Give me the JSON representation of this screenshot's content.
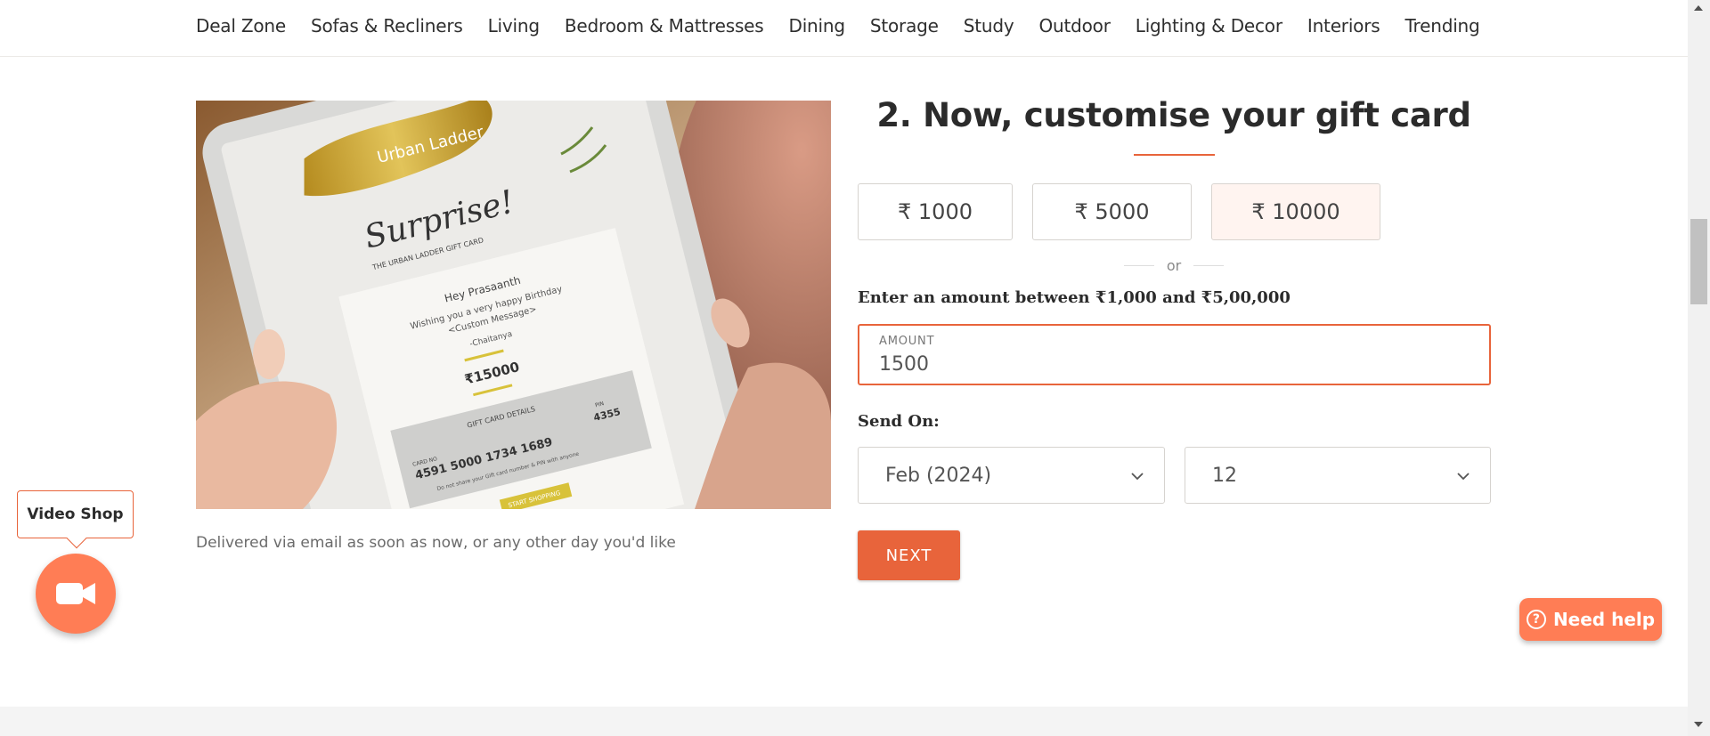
{
  "nav": {
    "items": [
      "Deal Zone",
      "Sofas & Recliners",
      "Living",
      "Bedroom & Mattresses",
      "Dining",
      "Storage",
      "Study",
      "Outdoor",
      "Lighting & Decor",
      "Interiors",
      "Trending"
    ]
  },
  "hero": {
    "card_brand": "Urban Ladder",
    "card_headline": "Surprise!",
    "card_subtitle": "THE URBAN LADDER GIFT CARD",
    "card_greeting": "Hey Prasaanth",
    "card_message_1": "Wishing you a very happy Birthday",
    "card_message_2": "<Custom Message>",
    "card_signature": "-Chaitanya",
    "card_amount": "₹15000",
    "card_details_label": "GIFT CARD DETAILS",
    "card_number_label": "CARD NO",
    "card_number": "4591 5000 1734 1689",
    "card_pin_label": "PIN",
    "card_pin": "4355",
    "card_disclaimer": "Do not share your Gift card number & PIN with anyone",
    "card_cta": "START SHOPPING"
  },
  "delivered_note": "Delivered via email as soon as now, or any other day you'd like",
  "form": {
    "title": "2. Now, customise your gift card",
    "amount_options": [
      "₹ 1000",
      "₹ 5000",
      "₹ 10000"
    ],
    "selected_option_index": 2,
    "or_text": "or",
    "range_label": "Enter an amount between ₹1,000 and  ₹5,00,000",
    "amount_label": "AMOUNT",
    "amount_value": "1500",
    "send_on_label": "Send On:",
    "month_value": "Feb (2024)",
    "day_value": "12",
    "next_label": "NEXT"
  },
  "widgets": {
    "video_shop_label": "Video Shop",
    "help_label": "Need help",
    "help_icon_glyph": "?"
  },
  "colors": {
    "accent": "#e8643b",
    "widget": "#ff7d55",
    "selected_option_bg": "#fff4f0"
  }
}
